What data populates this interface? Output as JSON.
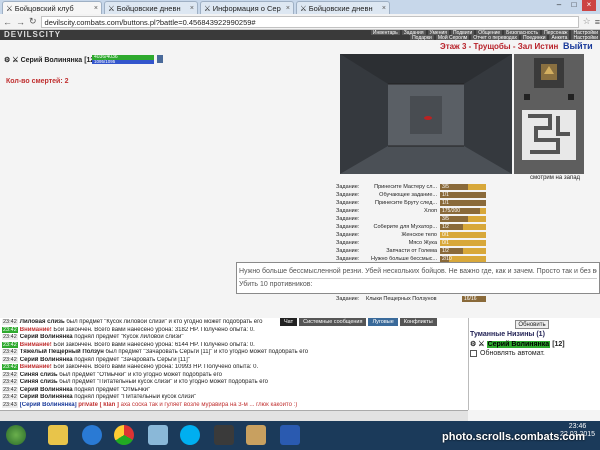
{
  "browser": {
    "tabs": [
      {
        "label": "Бойцовский клуб"
      },
      {
        "label": "Бойцовские дневн"
      },
      {
        "label": "Информация о Сер"
      },
      {
        "label": "Бойцовские дневн"
      }
    ],
    "url": "devilscity.combats.com/buttons.pl?battle=0.456843922990259#"
  },
  "game": {
    "logo": "DEVILSCITY",
    "menu_top": [
      "Инвентарь",
      "Задания",
      "Умения",
      "Подвиги",
      "Общение",
      "Безопасность",
      "Персонаж",
      "Настройки"
    ],
    "menu_bottom": [
      "Подарки",
      "Мой Серолм",
      "Отчет о переводах",
      "Поединки",
      "Анкета",
      "Настройки"
    ],
    "player": {
      "name": "Серий Волинянка",
      "level": "[12]",
      "hp": "4036/4036",
      "mp": "1095/1095"
    },
    "deaths": "Кол-во смертей: 2",
    "location": "Этаж 3 - Трущобы - Зал Истин",
    "exit": "Выйти",
    "looking": "смотрим на запад",
    "tasks": [
      {
        "label": "Задание:",
        "name": "Принесите Мастеру сл...",
        "progress": "3/5",
        "fill": 0.6
      },
      {
        "label": "Задание:",
        "name": "Обучающее задание...",
        "progress": "1/1",
        "fill": 1.0
      },
      {
        "label": "Задание:",
        "name": "Принесите Бруту след...",
        "progress": "1/1",
        "fill": 1.0
      },
      {
        "label": "Задание:",
        "name": "Хлоп",
        "progress": "175/200",
        "fill": 0.875
      },
      {
        "label": "Задание:",
        "name": "",
        "progress": "3/5",
        "fill": 0.6
      },
      {
        "label": "Задание:",
        "name": "Соберите для Мухатор...",
        "progress": "1/2",
        "fill": 0.5
      },
      {
        "label": "Задание:",
        "name": "Женское тело",
        "progress": "0/1",
        "fill": 0.0
      },
      {
        "label": "Задание:",
        "name": "Мясо Жука",
        "progress": "0/1",
        "fill": 0.0
      },
      {
        "label": "Задание:",
        "name": "Запчасти от Голема",
        "progress": "1/2",
        "fill": 0.5
      },
      {
        "label": "Задание:",
        "name": "Нужно больше бессмыс...",
        "progress": "2/10",
        "fill": 0.2
      }
    ],
    "tooltip": {
      "line1": "Нужно больше бессмысленной резни. Убей нескольких бойцов. Не важно где, как и зачем. Просто так и без вопросов.",
      "line2": "Убить 10 противников:"
    },
    "last_task": {
      "label": "Задание:",
      "name": "Клыки Пещерных Ползунов",
      "progress": "16/16",
      "fill": 1.0
    },
    "chat_tabs": [
      "Чат",
      "Системные сообщения",
      "Луговые",
      "Конфликты"
    ],
    "chat": [
      {
        "time": "23:42",
        "tc": "o",
        "pre": "",
        "name": "Лиловая слизь",
        "text": " был предмет \"Кусок лиловой слизи\" и кто угодно может подобрать его"
      },
      {
        "time": "23:42",
        "tc": "g",
        "pre": "Внимание!",
        "name": "",
        "text": " Бой закончен. Всего вами нанесено урона: 3182 HP. Получено опыта: 0."
      },
      {
        "time": "23:42",
        "tc": "o",
        "pre": "",
        "name": "Серий Волинянка",
        "text": " поднял предмет \"Кусок лиловой слизи\""
      },
      {
        "time": "23:42",
        "tc": "g",
        "pre": "Внимание!",
        "name": "",
        "text": " Бой закончен. Всего вами нанесено урона: 6144 HP. Получено опыта: 0."
      },
      {
        "time": "23:42",
        "tc": "o",
        "pre": "",
        "name": "Тяжелый Пещерный Ползун",
        "text": " был предмет \"Зачаровать Серьги [11]\" и кто угодно может подобрать его"
      },
      {
        "time": "23:42",
        "tc": "o",
        "pre": "",
        "name": "Серий Волинянка",
        "text": " поднял предмет \"Зачаровать Серьги [11]\""
      },
      {
        "time": "23:42",
        "tc": "g",
        "pre": "Внимание!",
        "name": "",
        "text": " Бой закончен. Всего вами нанесено урона: 10993 HP. Получено опыта: 0."
      },
      {
        "time": "23:42",
        "tc": "o",
        "pre": "",
        "name": "Синяя слизь",
        "text": " был предмет \"Отмычки\" и кто угодно может подобрать его"
      },
      {
        "time": "23:42",
        "tc": "o",
        "pre": "",
        "name": "Синяя слизь",
        "text": " был предмет \"Питательный кусок слизи\" и кто угодно может подобрать его"
      },
      {
        "time": "23:42",
        "tc": "o",
        "pre": "",
        "name": "Серий Волинянка",
        "text": " поднял предмет \"Отмычки\""
      },
      {
        "time": "23:42",
        "tc": "o",
        "pre": "",
        "name": "Серий Волинянка",
        "text": " поднял предмет \"Питательный кусок слизи\""
      }
    ],
    "private_line": {
      "time": "23:43",
      "who": "[Серий Волинянка]",
      "tag": "private [ klan ]",
      "text": "аха соска так и гуляет возле муравира на 3-м ... глюк какойто :)"
    },
    "right_panel": {
      "refresh": "Обновить",
      "room": "Туманные Низины (1)",
      "player": "Серий Волинянка",
      "level": "[12]",
      "auto": "Обновлять автомат."
    }
  },
  "os": {
    "clock_time": "23:46",
    "clock_date": "22.03.2015",
    "watermark": "photo.scrolls.combats.com"
  }
}
